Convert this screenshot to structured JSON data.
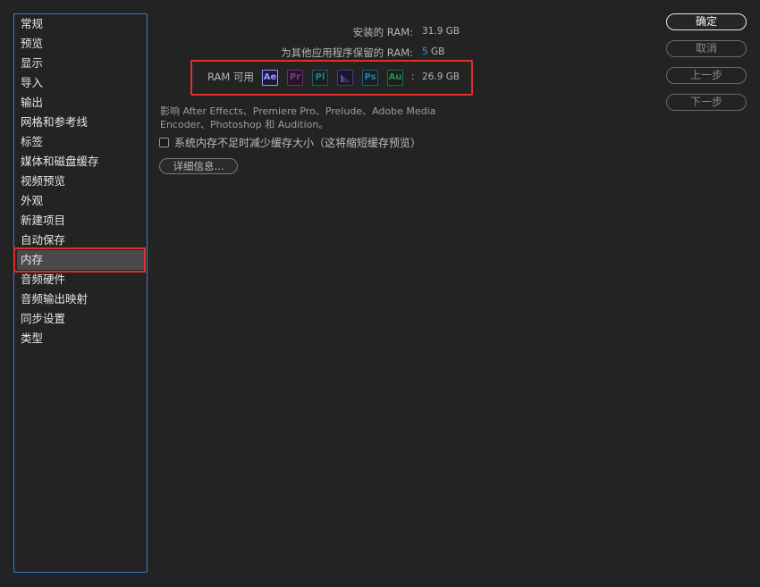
{
  "sidebar": {
    "items": [
      {
        "label": "常规"
      },
      {
        "label": "预览"
      },
      {
        "label": "显示"
      },
      {
        "label": "导入"
      },
      {
        "label": "输出"
      },
      {
        "label": "网格和参考线"
      },
      {
        "label": "标签"
      },
      {
        "label": "媒体和磁盘缓存"
      },
      {
        "label": "视频预览"
      },
      {
        "label": "外观"
      },
      {
        "label": "新建项目"
      },
      {
        "label": "自动保存"
      },
      {
        "label": "内存",
        "selected": true
      },
      {
        "label": "音频硬件"
      },
      {
        "label": "音频输出映射"
      },
      {
        "label": "同步设置"
      },
      {
        "label": "类型"
      }
    ]
  },
  "memory": {
    "installed_label": "安装的 RAM:",
    "installed_value": "31.9 GB",
    "reserved_label": "为其他应用程序保留的 RAM:",
    "reserved_num": "5",
    "reserved_unit": "GB",
    "available_label": "RAM 可用",
    "apps": [
      {
        "code": "Ae",
        "color": "#9999ff",
        "active": true
      },
      {
        "code": "Pr",
        "color": "#7a3a8a"
      },
      {
        "code": "Pl",
        "color": "#2f6f6f"
      },
      {
        "code": "Me",
        "color": "#5a4a8a"
      },
      {
        "code": "Ps",
        "color": "#2f6f8a"
      },
      {
        "code": "Au",
        "color": "#2f7a5a"
      }
    ],
    "available_value": "26.9 GB",
    "affect_text": "影响 After Effects、Premiere Pro、Prelude、Adobe Media Encoder、Photoshop 和 Audition。",
    "reduce_cache_label": "系统内存不足时减少缓存大小（这将缩短缓存预览）",
    "reduce_cache_checked": false,
    "details_button": "详细信息..."
  },
  "dialog_buttons": {
    "ok": "确定",
    "cancel": "取消",
    "previous": "上一步",
    "next": "下一步"
  }
}
